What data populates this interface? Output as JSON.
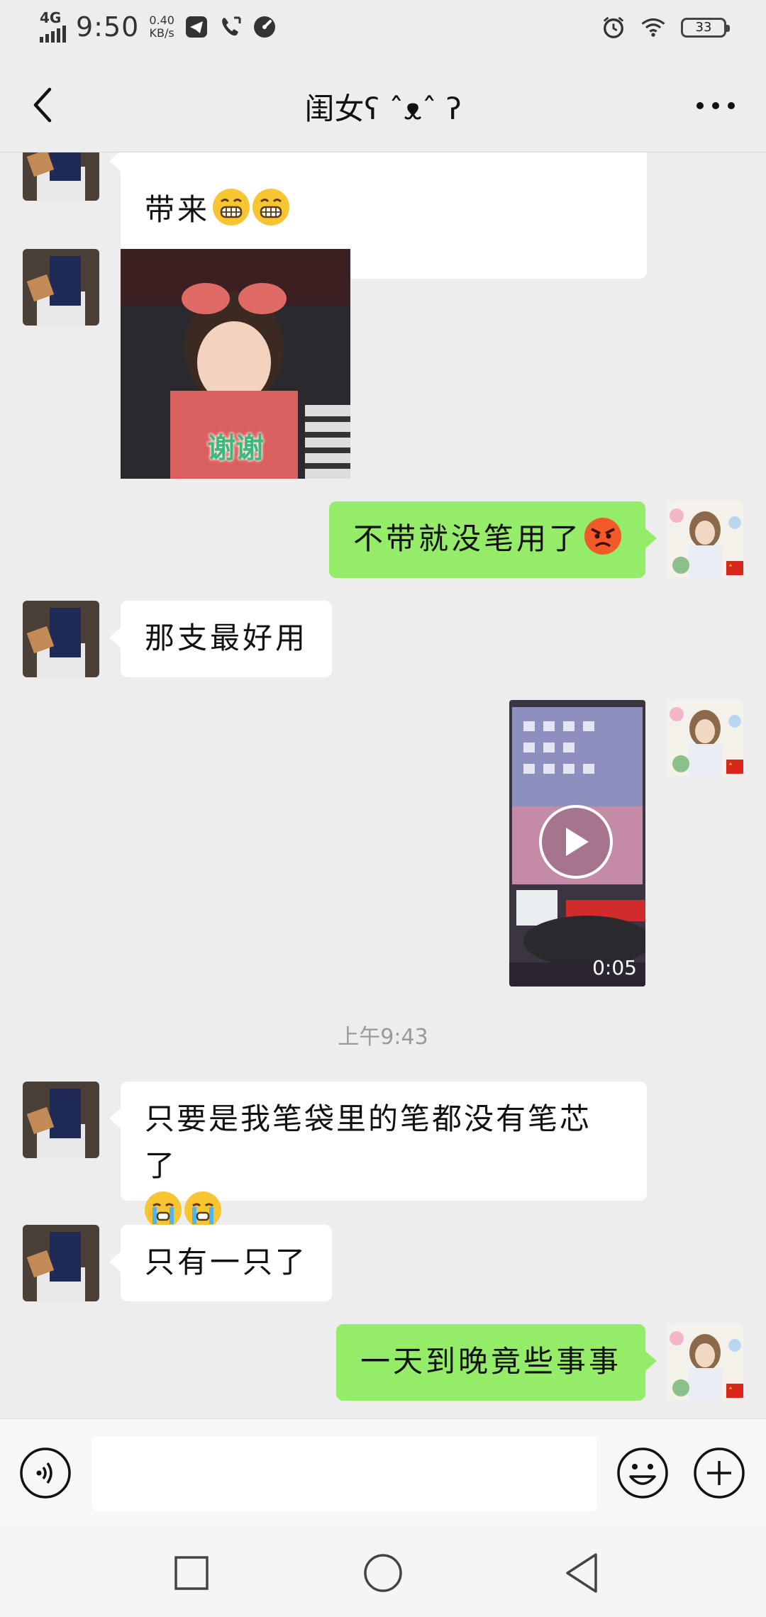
{
  "status_bar": {
    "network": "4G",
    "time": "9:50",
    "speed_value": "0.40",
    "speed_unit": "KB/s",
    "battery": "33",
    "icons": [
      "signal-icon",
      "telegram-icon",
      "phone-call-icon",
      "speedometer-icon",
      "alarm-icon",
      "wifi-icon",
      "battery-icon"
    ]
  },
  "header": {
    "title": "闺女ʕ ˆᴥˆ ʔ",
    "back_icon": "chevron-left-icon",
    "more_icon": "more-dots-icon"
  },
  "messages": [
    {
      "side": "in",
      "type": "text",
      "text": "带来",
      "emoji": [
        "grin-emoji",
        "grin-emoji"
      ],
      "partial": true
    },
    {
      "side": "in",
      "type": "sticker",
      "caption": "谢谢"
    },
    {
      "side": "out",
      "type": "text",
      "text": "不带就没笔用了",
      "emoji": [
        "angry-emoji"
      ]
    },
    {
      "side": "in",
      "type": "text",
      "text": "那支最好用"
    },
    {
      "side": "out",
      "type": "video",
      "duration": "0:05"
    },
    {
      "type": "timestamp",
      "text": "上午9:43"
    },
    {
      "side": "in",
      "type": "text",
      "text": "只要是我笔袋里的笔都没有笔芯了",
      "emoji": [
        "cry-emoji",
        "cry-emoji"
      ]
    },
    {
      "side": "in",
      "type": "text",
      "text": "只有一只了"
    },
    {
      "side": "out",
      "type": "text",
      "text": "一天到晚竟些事事"
    }
  ],
  "input_bar": {
    "voice_icon": "voice-icon",
    "input_value": "",
    "emoji_icon": "emoji-icon",
    "plus_icon": "plus-icon"
  },
  "nav_bar": {
    "icons": [
      "recents-square-icon",
      "home-circle-icon",
      "back-triangle-icon"
    ]
  },
  "colors": {
    "background": "#ededed",
    "out_bubble": "#95ec69",
    "in_bubble": "#ffffff"
  }
}
